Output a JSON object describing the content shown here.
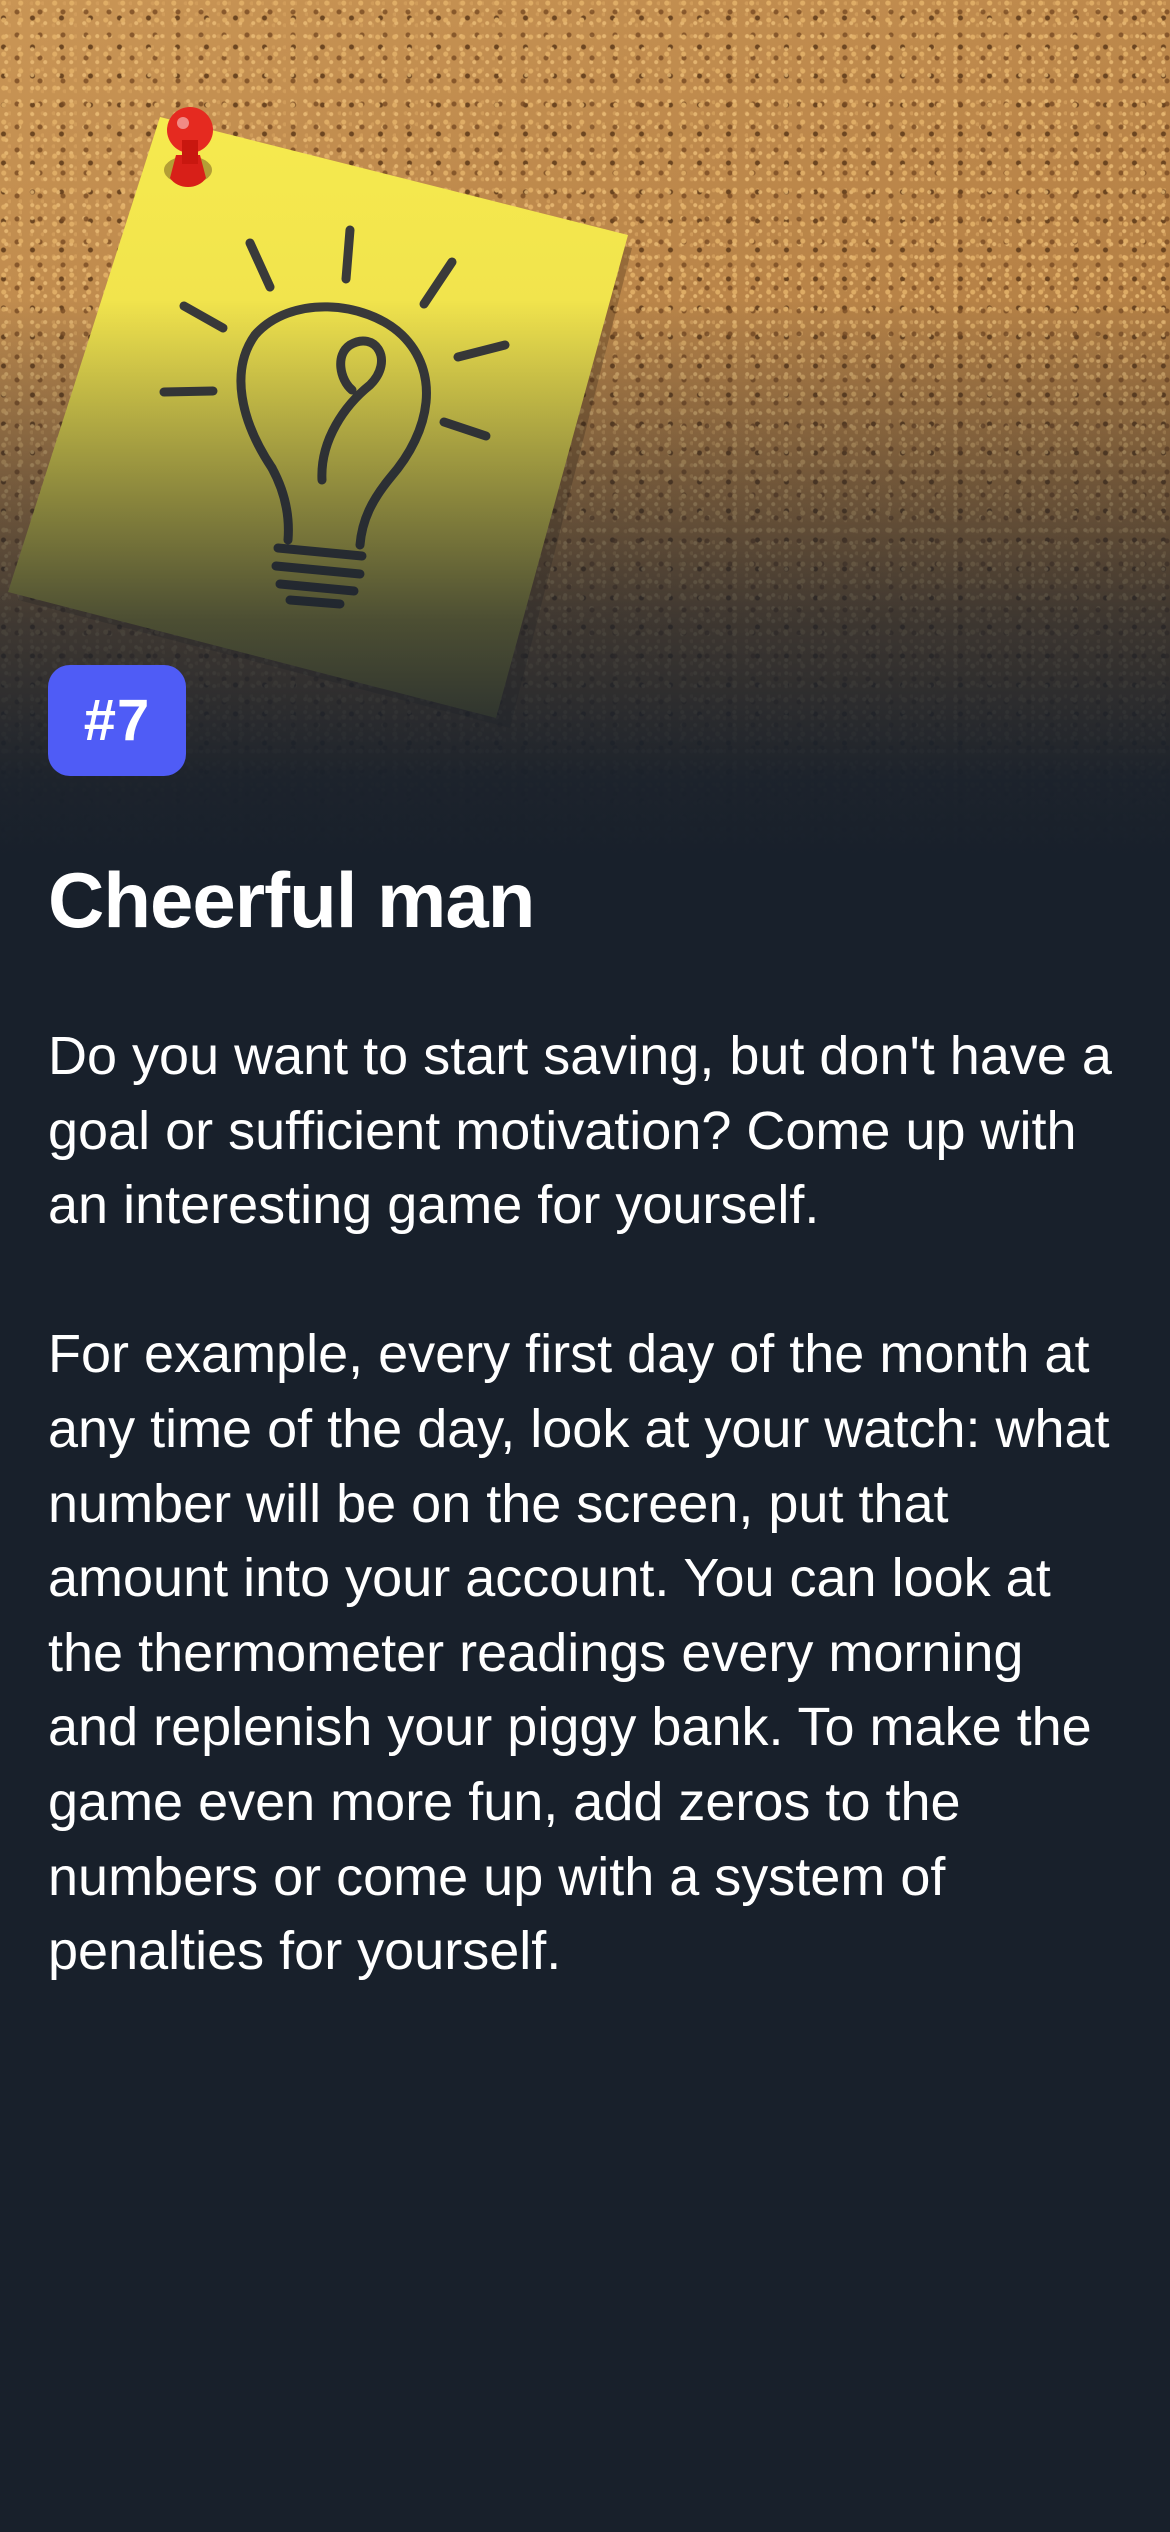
{
  "tip": {
    "number_badge": "#7",
    "title": "Cheerful man",
    "paragraphs": [
      "Do you want to start saving, but don't have a goal or sufficient motivation? Come up with an interesting game for yourself.",
      "For example, every first day of the month at any time of the day, look at your watch: what number will be on the screen, put that amount into your account. You can look at the thermometer readings every morning and replenish your piggy bank. To make the game even more fun, add zeros to the numbers or come up with a system of penalties for yourself."
    ]
  },
  "hero_image": {
    "subject": "yellow sticky note with lightbulb drawing pinned to corkboard",
    "icons": [
      "pushpin-icon",
      "lightbulb-icon"
    ]
  },
  "colors": {
    "background": "#18202b",
    "badge": "#4f5cf6",
    "sticky_note": "#f3e54a",
    "pin": "#e0231c",
    "text": "#ffffff"
  }
}
